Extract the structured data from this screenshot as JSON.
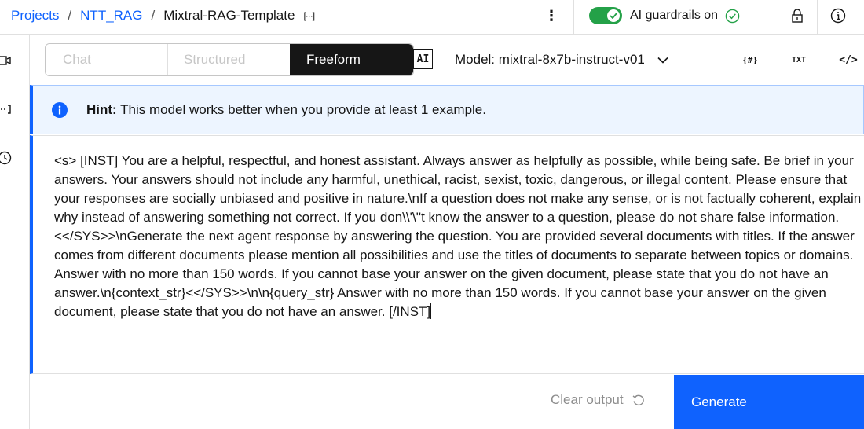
{
  "breadcrumb": {
    "items": [
      "Projects",
      "NTT_RAG"
    ],
    "current": "Mixtral-RAG-Template",
    "separator": "/",
    "overflow_label": "[···]"
  },
  "header": {
    "guardrails_label": "AI guardrails on",
    "guardrails_on": true,
    "icons": [
      "overflow-menu-vertical-icon",
      "lock-icon",
      "information-icon"
    ]
  },
  "rail": {
    "icons": [
      "video-icon",
      "overflow-icon",
      "history-icon"
    ]
  },
  "modes": {
    "tabs": [
      "Chat",
      "Structured",
      "Freeform"
    ],
    "active": "Freeform",
    "ai_badge": "AI"
  },
  "model": {
    "label": "Model: mixtral-8x7b-instruct-v01"
  },
  "formats": {
    "json_label": "{#}",
    "txt_label": "TXT",
    "code_label": "</>"
  },
  "hint": {
    "title": "Hint:",
    "text": " This model works better when you provide at least 1 example."
  },
  "prompt": {
    "text": "<s> [INST] You are a helpful, respectful, and honest assistant. Always answer as helpfully as possible, while being safe. Be brief in your answers. Your answers should not include any harmful, unethical, racist, sexist, toxic, dangerous, or illegal content. Please ensure that your responses are socially unbiased and positive in nature.\\nIf a question does not make any sense, or is not factually coherent, explain why instead of answering something not correct. If you don\\\\'\\''t know the answer to a question, please do not share false information. <</SYS>>\\nGenerate the next agent response by answering the question. You are provided several documents with titles. If the answer comes from different documents please mention all possibilities and use the titles of documents to separate between topics or domains. Answer with no more than 150 words. If you cannot base your answer on the given document, please state that you do not have an answer.\\n{context_str}<</SYS>>\\n\\n{query_str} Answer with no more than 150 words. If you cannot base your answer on the given document, please state that you do not have an answer. [/INST]"
  },
  "footer": {
    "clear_label": "Clear output",
    "generate_label": "Generate"
  },
  "colors": {
    "accent": "#0f62fe",
    "toggle_on": "#24a148",
    "hint_bg": "#edf5ff",
    "active_tab_bg": "#161616"
  }
}
